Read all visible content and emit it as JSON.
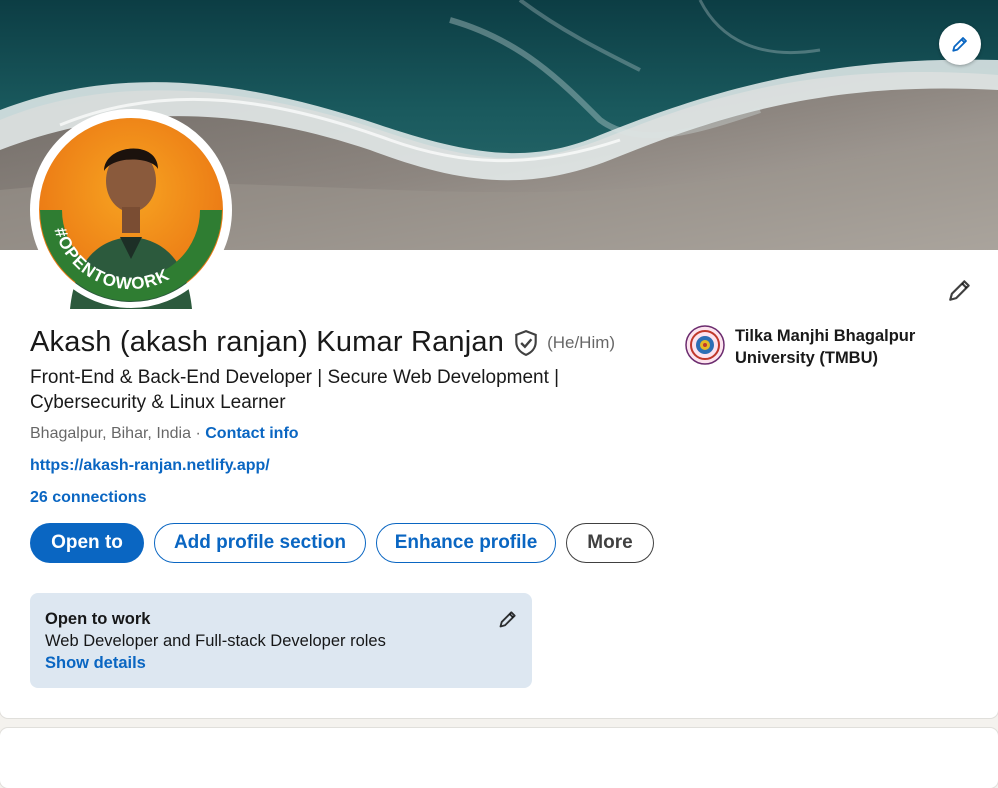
{
  "profile": {
    "name": "Akash (akash ranjan) Kumar Ranjan",
    "pronouns": "(He/Him)",
    "headline": "Front-End & Back-End Developer | Secure Web Development | Cybersecurity & Linux Learner",
    "location": "Bhagalpur, Bihar, India",
    "location_separator": " · ",
    "contact_info_label": "Contact info",
    "website": "https://akash-ranjan.netlify.app/",
    "connections": "26 connections",
    "avatar_frame_text": "#OPENTOWORK"
  },
  "actions": {
    "open_to": "Open to",
    "add_profile_section": "Add profile section",
    "enhance_profile": "Enhance profile",
    "more": "More"
  },
  "education": {
    "name": "Tilka Manjhi Bhagalpur University (TMBU)"
  },
  "open_to_work": {
    "title": "Open to work",
    "roles": "Web Developer and Full-stack Developer roles",
    "show_details": "Show details"
  },
  "icons": {
    "banner_edit": "pencil-icon",
    "profile_edit": "pencil-icon",
    "verification": "shield-check-icon",
    "open_to_work_edit": "pencil-icon"
  },
  "colors": {
    "accent": "#0a66c2",
    "open_to_work_bg": "#dde7f1",
    "opentowork_ring": "#2f7d32"
  }
}
